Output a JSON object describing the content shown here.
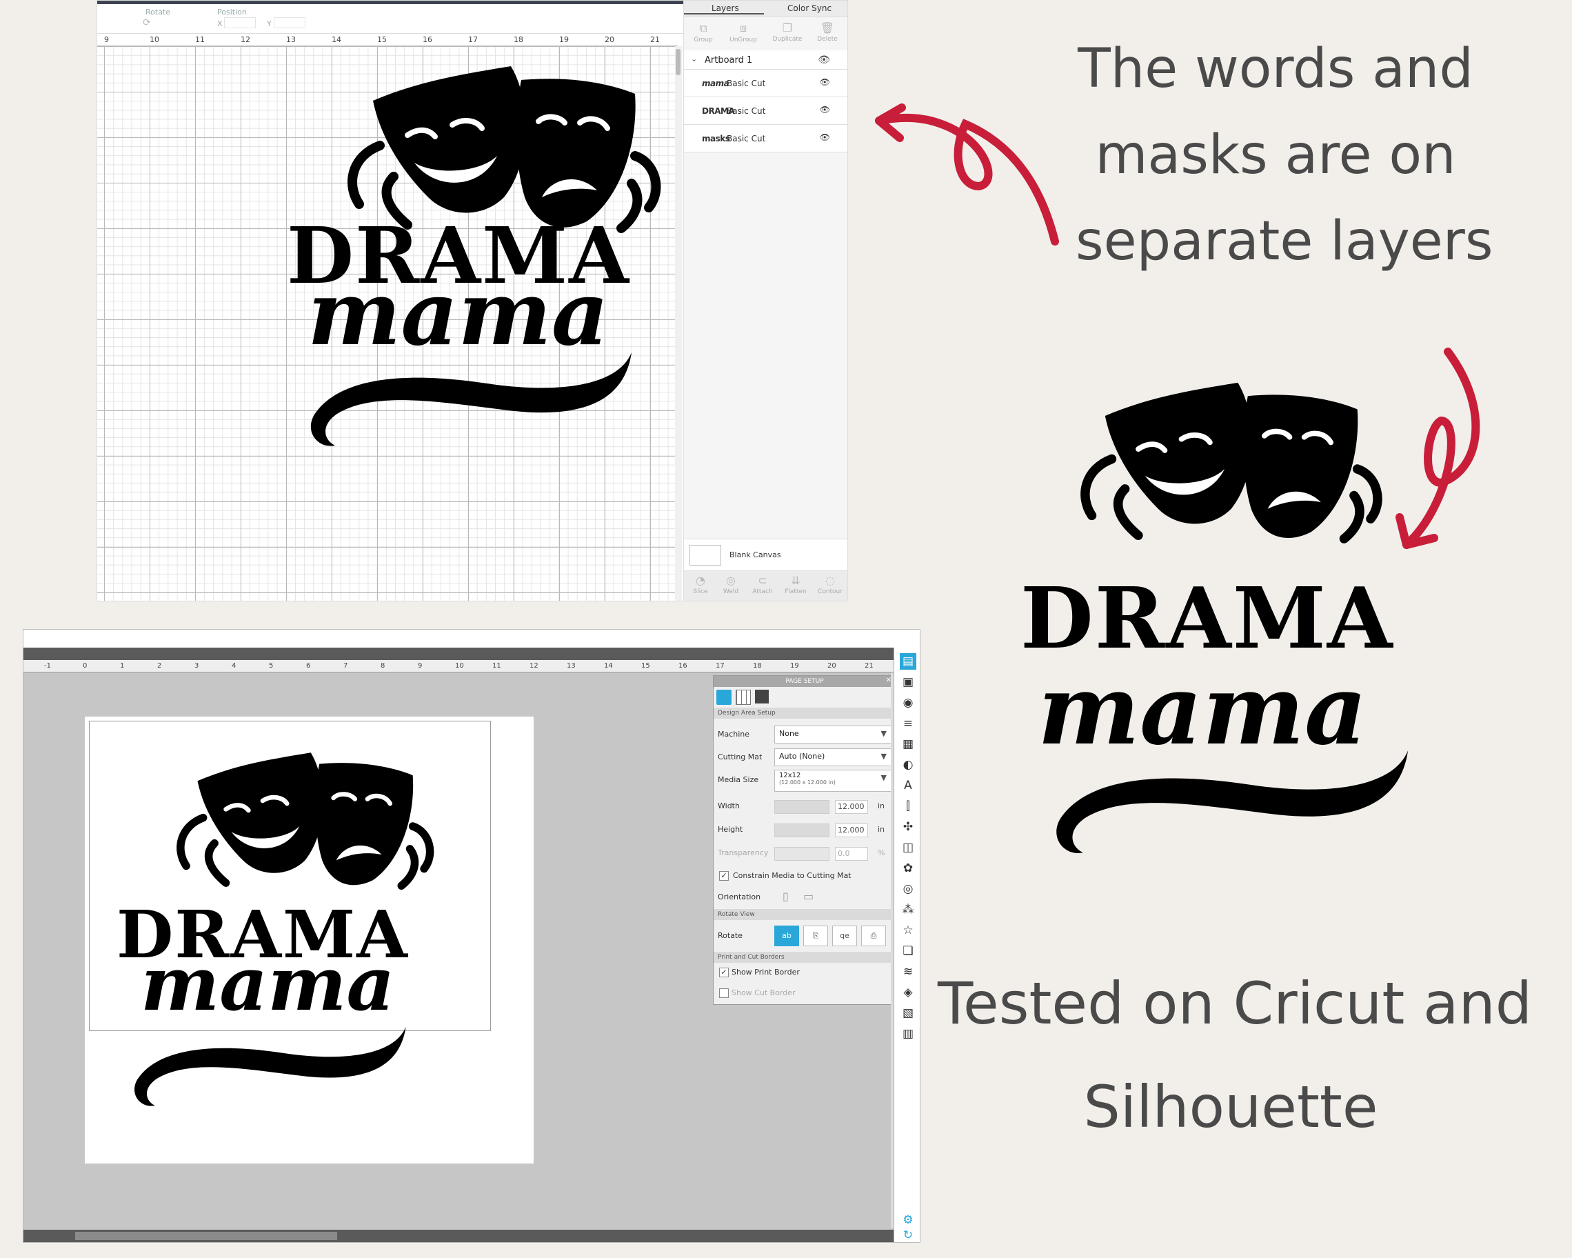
{
  "colors": {
    "background": "#f2efea",
    "caption": "#4a4a4a",
    "arrow": "#c81e3a",
    "accent": "#2aa7d9"
  },
  "captions": {
    "layers_line1": "The words and",
    "layers_line2": "masks are on",
    "layers_line3": "separate layers",
    "tested_line1": "Tested on Cricut and",
    "tested_line2": "Silhouette"
  },
  "artwork": {
    "title_word": "DRAMA",
    "script_word": "mama"
  },
  "cricut": {
    "toolbar": {
      "rotate_label": "Rotate",
      "position_label": "Position",
      "x_label": "X",
      "y_label": "Y"
    },
    "ruler": [
      "9",
      "10",
      "11",
      "12",
      "13",
      "14",
      "15",
      "16",
      "17",
      "18",
      "19",
      "20",
      "21"
    ],
    "tabs": {
      "layers": "Layers",
      "color_sync": "Color Sync"
    },
    "layer_tools": [
      {
        "label": "Group",
        "icon": "group-icon"
      },
      {
        "label": "UnGroup",
        "icon": "ungroup-icon"
      },
      {
        "label": "Duplicate",
        "icon": "duplicate-icon"
      },
      {
        "label": "Delete",
        "icon": "trash-icon"
      }
    ],
    "artboard": "Artboard 1",
    "layers": [
      {
        "name": "Basic Cut",
        "thumb": "mama"
      },
      {
        "name": "Basic Cut",
        "thumb": "DRAMA"
      },
      {
        "name": "Basic Cut",
        "thumb": "masks"
      }
    ],
    "blank_canvas": "Blank Canvas",
    "bottom_tools": [
      {
        "label": "Slice"
      },
      {
        "label": "Weld"
      },
      {
        "label": "Attach"
      },
      {
        "label": "Flatten"
      },
      {
        "label": "Contour"
      }
    ]
  },
  "silhouette": {
    "ruler": [
      "-1",
      "0",
      "1",
      "2",
      "3",
      "4",
      "5",
      "6",
      "7",
      "8",
      "9",
      "10",
      "11",
      "12",
      "13",
      "14",
      "15",
      "16",
      "17",
      "18",
      "19",
      "20",
      "21"
    ],
    "page_setup": {
      "title": "PAGE SETUP",
      "design_area": "Design Area Setup",
      "machine_label": "Machine",
      "machine_value": "None",
      "mat_label": "Cutting Mat",
      "mat_value": "Auto (None)",
      "media_label": "Media Size",
      "media_value": "12x12",
      "media_detail": "(12.000 x 12.000 in)",
      "width_label": "Width",
      "width_value": "12.000",
      "width_unit": "in",
      "height_label": "Height",
      "height_value": "12.000",
      "height_unit": "in",
      "transparency_label": "Transparency",
      "transparency_value": "0.0",
      "transparency_unit": "%",
      "constrain_label": "Constrain Media to Cutting Mat",
      "orientation_label": "Orientation",
      "rotate_view": "Rotate View",
      "rotate_label": "Rotate",
      "borders_section": "Print and Cut Borders",
      "print_border": "Show Print Border",
      "cut_border": "Show Cut Border"
    }
  }
}
